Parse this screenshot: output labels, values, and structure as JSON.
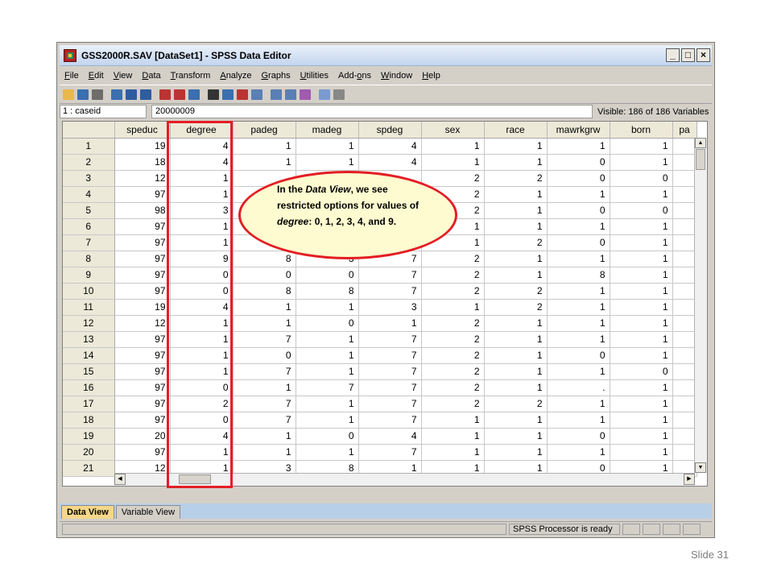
{
  "window": {
    "title": "GSS2000R.SAV [DataSet1] - SPSS Data Editor"
  },
  "menu": [
    "File",
    "Edit",
    "View",
    "Data",
    "Transform",
    "Analyze",
    "Graphs",
    "Utilities",
    "Add-ons",
    "Window",
    "Help"
  ],
  "menu_underline": [
    "F",
    "E",
    "V",
    "D",
    "T",
    "A",
    "G",
    "U",
    "o",
    "W",
    "H"
  ],
  "cellbar": {
    "ref": "1 : caseid",
    "value": "20000009",
    "visible": "Visible: 186 of 186 Variables"
  },
  "grid": {
    "columns": [
      "speduc",
      "degree",
      "padeg",
      "madeg",
      "spdeg",
      "sex",
      "race",
      "mawrkgrw",
      "born",
      "pa"
    ],
    "rows": [
      [
        "1",
        "19",
        "4",
        "1",
        "1",
        "4",
        "1",
        "1",
        "1",
        "1"
      ],
      [
        "2",
        "18",
        "4",
        "1",
        "1",
        "4",
        "1",
        "1",
        "0",
        "1"
      ],
      [
        "3",
        "12",
        "1",
        "",
        "",
        "",
        "2",
        "2",
        "0",
        "0"
      ],
      [
        "4",
        "97",
        "1",
        "",
        "",
        "",
        "2",
        "1",
        "1",
        "1"
      ],
      [
        "5",
        "98",
        "3",
        "",
        "",
        "",
        "2",
        "1",
        "0",
        "0"
      ],
      [
        "6",
        "97",
        "1",
        "",
        "",
        "",
        "1",
        "1",
        "1",
        "1"
      ],
      [
        "7",
        "97",
        "1",
        "",
        "",
        "",
        "1",
        "2",
        "0",
        "1"
      ],
      [
        "8",
        "97",
        "9",
        "8",
        "3",
        "7",
        "2",
        "1",
        "1",
        "1"
      ],
      [
        "9",
        "97",
        "0",
        "0",
        "0",
        "7",
        "2",
        "1",
        "8",
        "1"
      ],
      [
        "10",
        "97",
        "0",
        "8",
        "8",
        "7",
        "2",
        "2",
        "1",
        "1"
      ],
      [
        "11",
        "19",
        "4",
        "1",
        "1",
        "3",
        "1",
        "2",
        "1",
        "1"
      ],
      [
        "12",
        "12",
        "1",
        "1",
        "0",
        "1",
        "2",
        "1",
        "1",
        "1"
      ],
      [
        "13",
        "97",
        "1",
        "7",
        "1",
        "7",
        "2",
        "1",
        "1",
        "1"
      ],
      [
        "14",
        "97",
        "1",
        "0",
        "1",
        "7",
        "2",
        "1",
        "0",
        "1"
      ],
      [
        "15",
        "97",
        "1",
        "7",
        "1",
        "7",
        "2",
        "1",
        "1",
        "0"
      ],
      [
        "16",
        "97",
        "0",
        "1",
        "7",
        "7",
        "2",
        "1",
        ".",
        "1"
      ],
      [
        "17",
        "97",
        "2",
        "7",
        "1",
        "7",
        "2",
        "2",
        "1",
        "1"
      ],
      [
        "18",
        "97",
        "0",
        "7",
        "1",
        "7",
        "1",
        "1",
        "1",
        "1"
      ],
      [
        "19",
        "20",
        "4",
        "1",
        "0",
        "4",
        "1",
        "1",
        "0",
        "1"
      ],
      [
        "20",
        "97",
        "1",
        "1",
        "1",
        "7",
        "1",
        "1",
        "1",
        "1"
      ],
      [
        "21",
        "12",
        "1",
        "3",
        "8",
        "1",
        "1",
        "1",
        "0",
        "1"
      ]
    ]
  },
  "callout": {
    "parts": [
      {
        "t": "In the ",
        "i": false
      },
      {
        "t": "Data View",
        "i": true
      },
      {
        "t": ", we see restricted options for values of ",
        "i": false
      },
      {
        "t": "degree",
        "i": true
      },
      {
        "t": ": 0, 1, 2, 3, 4, and 9.",
        "i": false
      }
    ]
  },
  "tabs": {
    "data_view": "Data View",
    "variable_view": "Variable View"
  },
  "status": {
    "text": "SPSS  Processor is ready"
  },
  "slide": {
    "label": "Slide 31"
  },
  "colors": {
    "highlight": "#e31e24",
    "callout_fill": "#fefbd0",
    "active_tab": "#f5d78a"
  },
  "icons": [
    "open-icon",
    "save-icon",
    "print-icon",
    "dialog-recall-icon",
    "undo-icon",
    "redo-icon",
    "goto-case-icon",
    "goto-variable-icon",
    "variables-icon",
    "find-icon",
    "insert-cases-icon",
    "insert-variable-icon",
    "split-file-icon",
    "weight-cases-icon",
    "select-cases-icon",
    "value-labels-icon",
    "use-sets-icon",
    "show-all-icon"
  ]
}
